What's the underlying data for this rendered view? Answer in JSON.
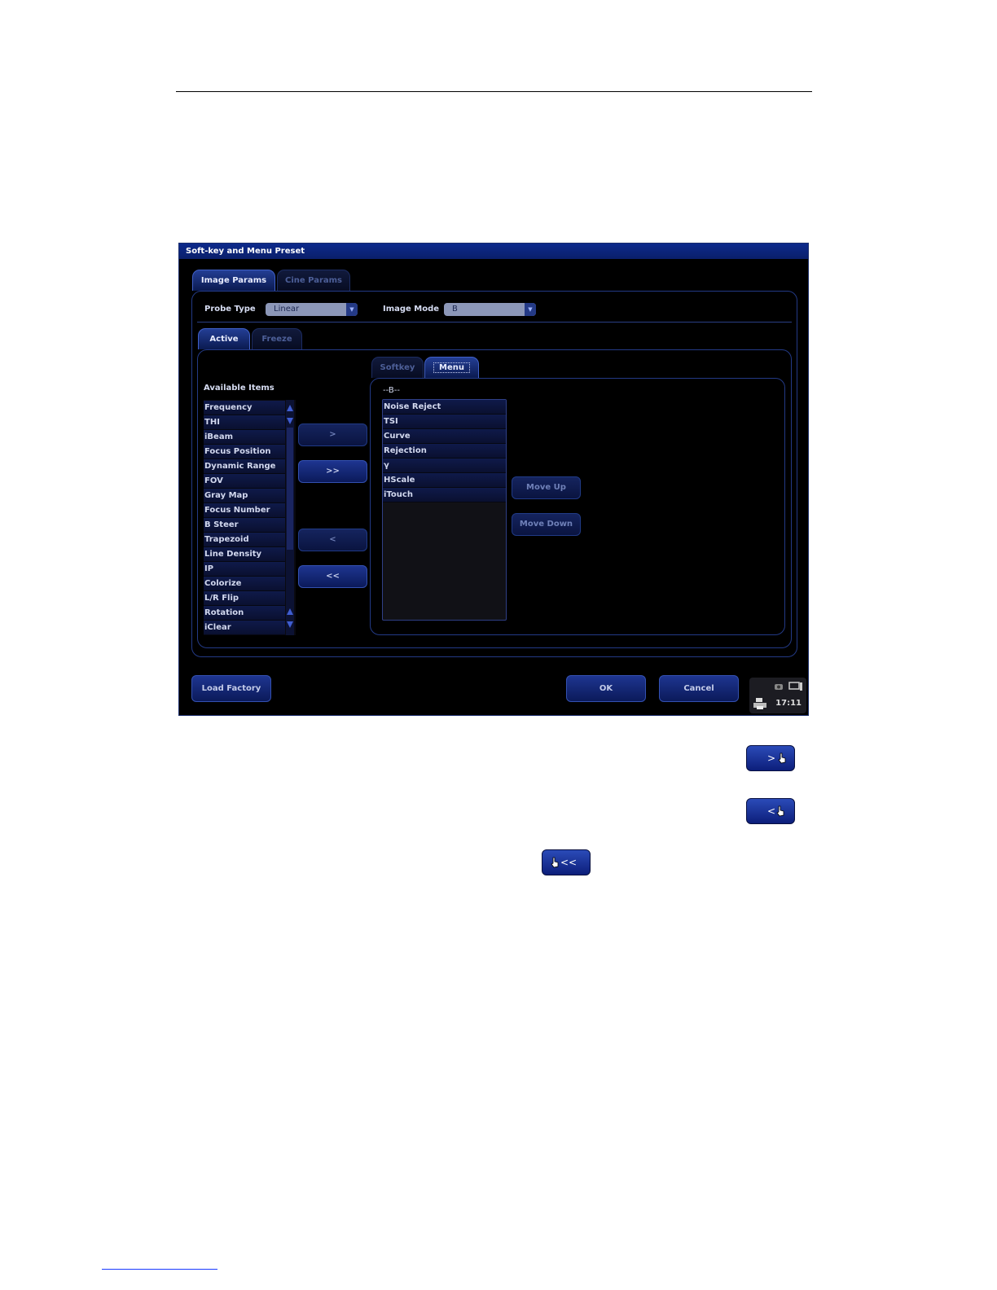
{
  "window": {
    "title": "Soft-key and Menu Preset"
  },
  "main_tabs": [
    {
      "label": "Image Params",
      "active": true
    },
    {
      "label": "Cine Params",
      "active": false
    }
  ],
  "probe_type": {
    "label": "Probe Type",
    "value": "Linear"
  },
  "image_mode": {
    "label": "Image Mode",
    "value": "B"
  },
  "state_tabs": [
    {
      "label": "Active",
      "active": true
    },
    {
      "label": "Freeze",
      "active": false
    }
  ],
  "available": {
    "label": "Available Items",
    "items": [
      "Frequency",
      "THI",
      "iBeam",
      "Focus Position",
      "Dynamic Range",
      "FOV",
      "Gray Map",
      "Focus Number",
      "B Steer",
      "Trapezoid",
      "Line Density",
      "IP",
      "Colorize",
      "L/R Flip",
      "Rotation",
      "iClear"
    ]
  },
  "transfer_buttons": {
    "add": ">",
    "add_all": ">>",
    "remove": "<",
    "remove_all": "<<"
  },
  "sub_tabs": [
    {
      "label": "Softkey",
      "active": false
    },
    {
      "label": "Menu",
      "active": true
    }
  ],
  "selected": {
    "header": "--B--",
    "items": [
      "Noise Reject",
      "TSI",
      "Curve",
      "Rejection",
      "γ",
      "HScale",
      "iTouch"
    ]
  },
  "order_buttons": {
    "move_up": "Move Up",
    "move_down": "Move Down"
  },
  "footer": {
    "load_factory": "Load Factory",
    "ok": "OK",
    "cancel": "Cancel"
  },
  "status_bar": {
    "time": "17:11"
  },
  "inline_buttons": {
    "add_label": ">",
    "remove_label": "<",
    "remove_all_label": "<<"
  },
  "colors": {
    "accent": "#1e3590",
    "background": "#000000",
    "title_bar": "#0d2a8c"
  }
}
